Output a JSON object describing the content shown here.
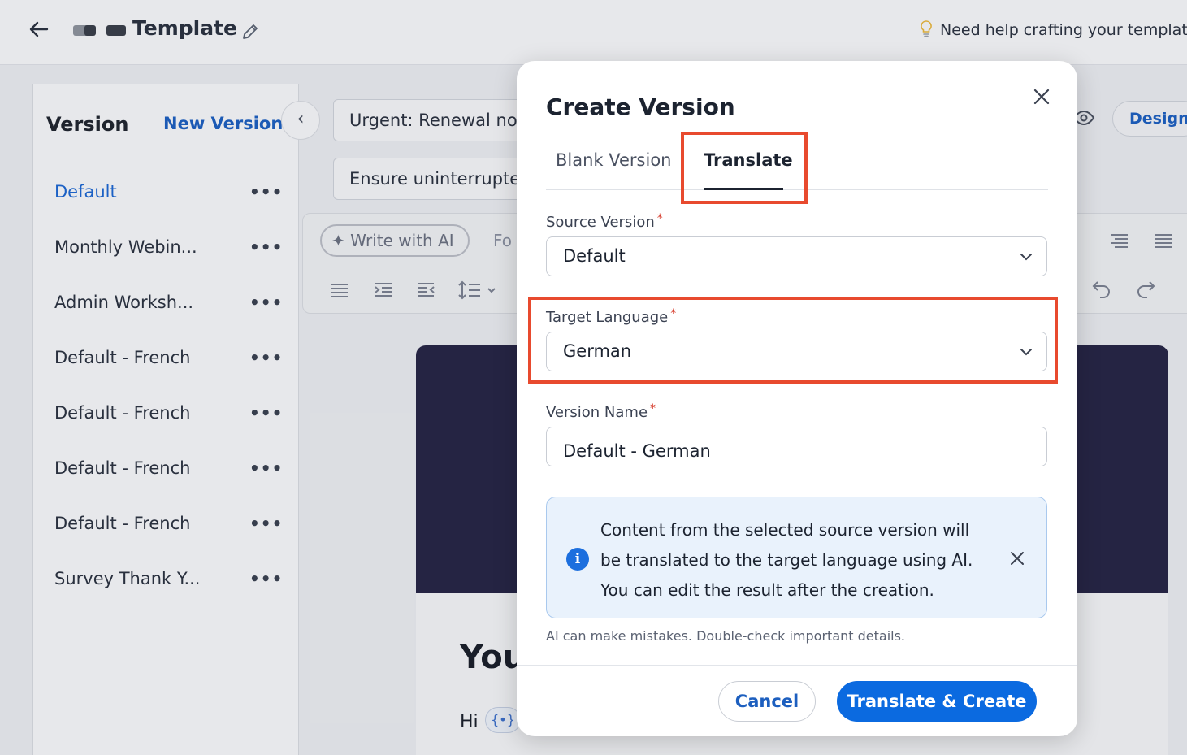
{
  "header": {
    "back_icon": "arrow-left-icon",
    "title": "Template",
    "edit_icon": "pencil-icon",
    "help_text": "Need help crafting your template?",
    "help_icon": "lightbulb-icon"
  },
  "sidebar": {
    "title": "Version",
    "new_version_label": "New Version",
    "items": [
      {
        "label": "Default",
        "active": true
      },
      {
        "label": "Monthly Webin..."
      },
      {
        "label": "Admin Worksh..."
      },
      {
        "label": "Default - French"
      },
      {
        "label": "Default - French"
      },
      {
        "label": "Default - French"
      },
      {
        "label": "Default - French"
      },
      {
        "label": "Survey Thank Y..."
      }
    ],
    "more_glyph": "•••",
    "collapse_glyph": "‹"
  },
  "editor": {
    "subject_value": "Urgent: Renewal noti",
    "preheader_value": "Ensure uninterrupted",
    "write_ai_label": "✦ Write with AI",
    "format_label_partial": "Fo",
    "design_label": "Design",
    "canvas_heading_partial": "You",
    "canvas_greeting": "Hi",
    "variable_chip": "{•}"
  },
  "modal": {
    "title": "Create Version",
    "tabs": [
      {
        "label": "Blank Version",
        "selected": false
      },
      {
        "label": "Translate",
        "selected": true
      }
    ],
    "source_version": {
      "label": "Source Version",
      "required_mark": "*",
      "value": "Default"
    },
    "target_language": {
      "label": "Target Language",
      "required_mark": "*",
      "value": "German"
    },
    "version_name": {
      "label": "Version Name",
      "required_mark": "*",
      "value": "Default - German"
    },
    "info_icon_glyph": "i",
    "info_text": "Content from the selected source version will be translated to the target language using AI. You can edit the result after the creation.",
    "disclaimer": "AI can make mistakes. Double-check important details.",
    "cancel_label": "Cancel",
    "submit_label": "Translate & Create"
  },
  "colors": {
    "accent": "#0b6ae0",
    "link": "#1d5fbf",
    "highlight_outline": "#e84a2e",
    "info_bg": "#e9f2fc",
    "banner": "#272646"
  }
}
